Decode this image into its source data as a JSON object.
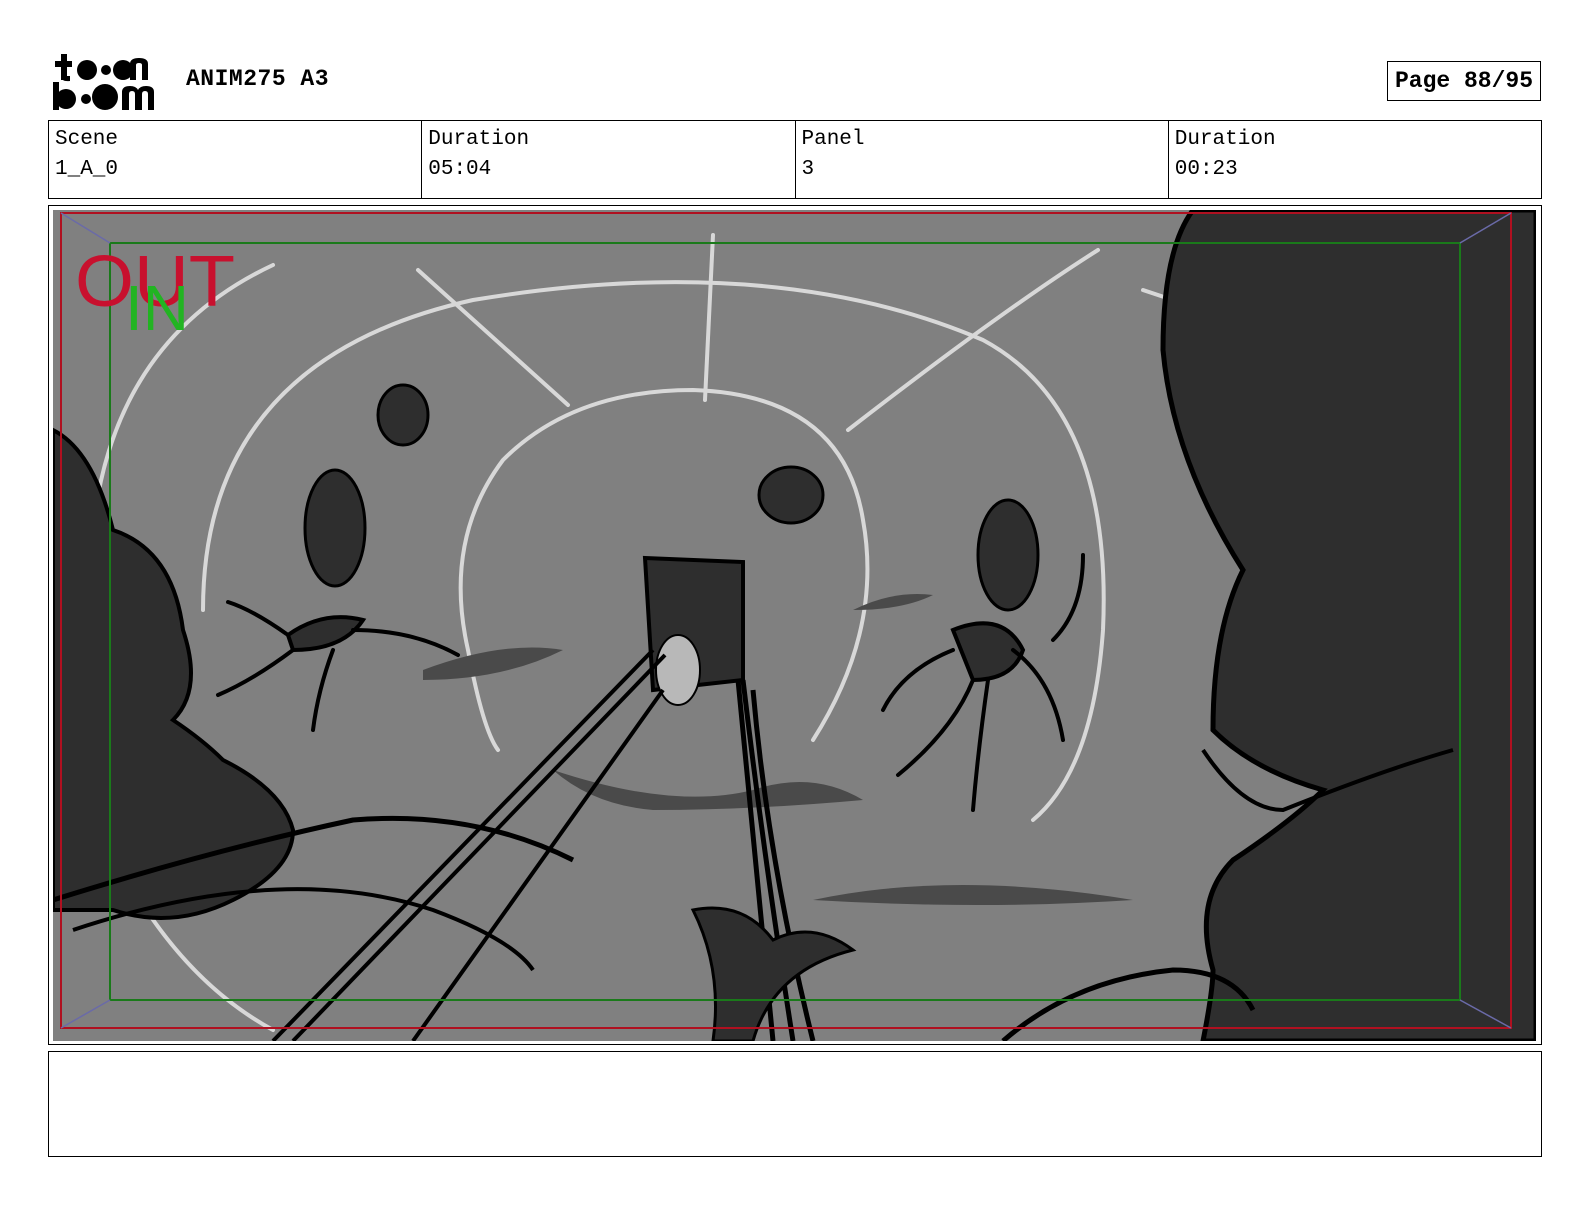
{
  "header": {
    "logo_text": "toon boom",
    "project_title": "ANIM275 A3",
    "page_label": "Page 88/95"
  },
  "info": {
    "scene_label": "Scene",
    "scene_value": "1_A_0",
    "scene_duration_label": "Duration",
    "scene_duration_value": "05:04",
    "panel_label": "Panel",
    "panel_value": "3",
    "panel_duration_label": "Duration",
    "panel_duration_value": "00:23"
  },
  "panel": {
    "out_marker": "OUT",
    "in_marker": "IN",
    "colors": {
      "background": "#808080",
      "dark_shapes": "#2e2e2e",
      "light_lines": "#d8d8d8",
      "out_frame": "#b01020",
      "in_frame": "#1a7a1a",
      "out_text": "#c8102e",
      "in_text": "#22b422"
    }
  },
  "caption": {
    "text": ""
  }
}
